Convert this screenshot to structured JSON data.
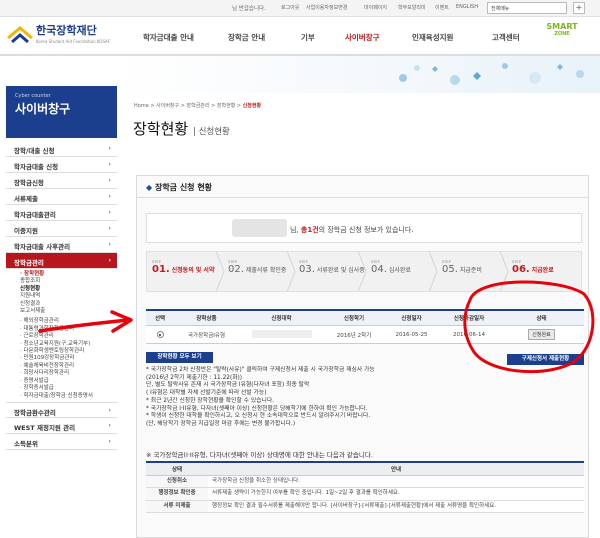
{
  "topbar": {
    "greeting": "님 반갑습니다.",
    "links": [
      "로그아웃",
      "사업이용자정보변경",
      "마이페이지",
      "학부모알리미",
      "이벤트",
      "ENGLISH"
    ],
    "search_placeholder": "전체메뉴",
    "plus_label": "+"
  },
  "header": {
    "logo_title": "한국장학재단",
    "logo_sub": "Korea Student Aid Foundation KOSAF",
    "gnb": [
      "학자금대출 안내",
      "장학금 안내",
      "기부",
      "사이버창구",
      "인재육성지원",
      "고객센터"
    ],
    "active_gnb": "사이버창구",
    "smart_line1": "SMART",
    "smart_line2": "ZONE"
  },
  "sidebar": {
    "head_en": "Cyber counter",
    "head_ko": "사이버창구",
    "items": [
      {
        "label": "장학/대출 신청"
      },
      {
        "label": "학자금대출 신청"
      },
      {
        "label": "장학금신청"
      },
      {
        "label": "서류제출"
      },
      {
        "label": "학자금대출관리"
      },
      {
        "label": "이중지원"
      },
      {
        "label": "학자금대출 사후관리"
      },
      {
        "label": "장학금관리"
      }
    ],
    "sub_items": [
      "· 장학현황",
      "종합조회",
      "신청현황",
      "지원내역",
      "신청결과",
      "보고서제출",
      "· 해외장학금관리",
      "· 대통령과학장학금관리",
      "· 근로장학관리",
      "· 청소년교육지원(구,교육기부)",
      "· 다문화학생멘토링장학관리",
      "· 민원109강장학금관리",
      "· 예술체육비전장학관리",
      "· 희망사다리장학관리",
      "· 증명서발급",
      "· 장학증서발급",
      "· 학자금대출/장학금 신청증명서"
    ],
    "bottom_items": [
      {
        "label": "장학금환수관리"
      },
      {
        "label": "WEST 재정지원 관리"
      },
      {
        "label": "소득분위"
      }
    ]
  },
  "breadcrumb": {
    "trail": "Home > 사이버창구 > 장학금관리 > 장학현황 >",
    "current": "신청현황"
  },
  "page": {
    "title": "장학현황",
    "subtitle": "신청현황"
  },
  "section": {
    "title": "장학금 신청 현황",
    "notice_pre": "님,",
    "notice_count": "총1건",
    "notice_post": "의 장학금 신청 정보가 있습니다."
  },
  "steps": [
    {
      "label": "STEP",
      "num": "01.",
      "text": "신청동의 및 서약",
      "active": true
    },
    {
      "label": "STEP",
      "num": "02.",
      "text": "제출서류 확인중",
      "active": false
    },
    {
      "label": "STEP",
      "num": "03.",
      "text": "서류완료 및 심사중",
      "active": false
    },
    {
      "label": "STEP",
      "num": "04.",
      "text": "심사완료",
      "active": false
    },
    {
      "label": "STEP",
      "num": "05.",
      "text": "지급준비",
      "active": false
    },
    {
      "label": "STEP",
      "num": "06.",
      "text": "지급완료",
      "active": true
    }
  ],
  "apply_table": {
    "headers": [
      "선택",
      "장학상품",
      "신청대학",
      "신청학기",
      "신청일자",
      "신청마감일자",
      "상태"
    ],
    "rows": [
      {
        "product": "국가장학금I유형",
        "univ": "",
        "semester": "2016년 2학기",
        "date": "2016-05-25",
        "deadline": "2016-06-14",
        "status": "신청완료"
      }
    ]
  },
  "buttons": {
    "show_all": "장학현황 모두 보기",
    "doc_submit": "구제신청서 제출현황"
  },
  "notes": [
    "* 국가장학금 2차 신청반은 \"탈락(사유)\" 클릭하여 구제신청서 제출 시 국가장학금 재심사 가능",
    "  (2016년 2학기 제출기한 : 11.22(화))",
    "  단, 별도 탈락사유 존재 시 국가장학금 I유형(다자녀 포함) 최종 탈락",
    "  ( I유형은 대학별 자체 선발기준에 따라 선발 가능)",
    "* 최근 2년간 신청한 장학현황을 확인할 수 있습니다.",
    "* 국가장학금 I·II유형, 다자녀(셋째아 이상) 신청현황은 당해학기에 한하여 확인 가능합니다.",
    "* 학생이 신청한 대학을 확인하시고, 오 신청시 현 소속대학으로 반드시 알려주시기 바랍니다.",
    "  (단, 해당학기 장학금 지급일정 마감 후에는 변경 불가합니다.)"
  ],
  "guide": {
    "title": "※ 국가장학금(I·II유형, 다자녀(셋째아 이상) 상태명에 대한 안내는 다음과 같습니다.",
    "headers": [
      "상태",
      "안내"
    ],
    "rows": [
      {
        "status": "신청취소",
        "text": "국가장학금 신청을 취소한 상태입니다."
      },
      {
        "status": "행정정보 확인중",
        "text": "서류제출 생략이 가능한지 여부를 확인 중입니다. 1일~2일 후 결과를 확인하세요."
      },
      {
        "status": "서류 미제출",
        "text": "행정정보 확인 결과 필수서류를 제출해야만 합니다. [사이버창구]-[서류제출]-[서류제출현황]에서 제출 서류명을 확인하세요."
      }
    ]
  },
  "colors": {
    "brand_navy": "#1b3e8d",
    "accent_red": "#b7161d",
    "annotation_red": "#e8000b"
  }
}
